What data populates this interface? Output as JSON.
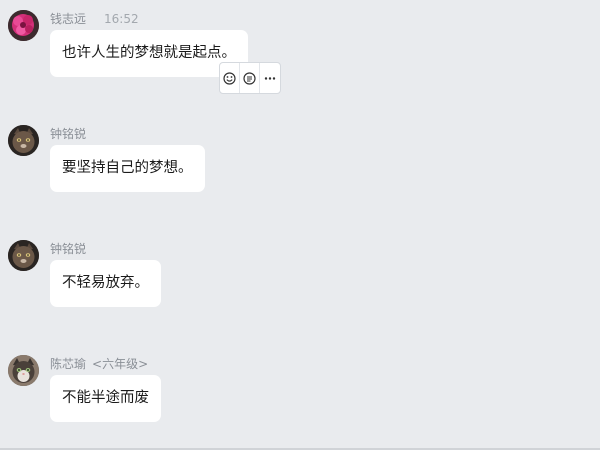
{
  "messages": [
    {
      "sender": "钱志远",
      "time": "16:52",
      "text": "也许人生的梦想就是起点。",
      "avatar": "pink-flower-avatar"
    },
    {
      "sender": "钟铭锐",
      "text": "要坚持自己的梦想。",
      "avatar": "cat-avatar"
    },
    {
      "sender": "钟铭锐",
      "text": "不轻易放弃。",
      "avatar": "cat-avatar"
    },
    {
      "sender": "陈芯瑜",
      "tag": "<六年级>",
      "text": "不能半途而废",
      "avatar": "kitten-avatar"
    }
  ],
  "toolbar": {
    "icons": [
      "emoji-icon",
      "quote-icon",
      "more-icon"
    ]
  },
  "colors": {
    "background": "#e9ebee",
    "bubble": "#ffffff",
    "meta_text": "#8a8f96"
  }
}
